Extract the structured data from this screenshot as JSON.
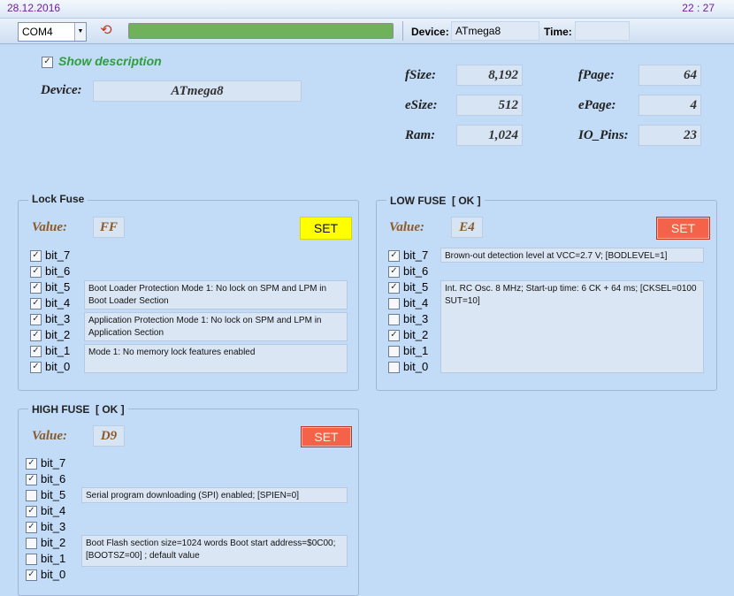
{
  "titlebar": {
    "date": "28.12.2016",
    "time": "22 : 27"
  },
  "toolbar": {
    "port": "COM4",
    "progress": 1.0,
    "device_label": "Device:",
    "device_value": "ATmega8",
    "time_label": "Time:",
    "time_value": ""
  },
  "info": {
    "show_description_label": "Show description",
    "show_description_checked": true,
    "device_label": "Device:",
    "device_value": "ATmega8",
    "fsize_label": "fSize:",
    "fsize": "8,192",
    "esize_label": "eSize:",
    "esize": "512",
    "ram_label": "Ram:",
    "ram": "1,024",
    "fpage_label": "fPage:",
    "fpage": "64",
    "epage_label": "ePage:",
    "epage": "4",
    "iopins_label": "IO_Pins:",
    "iopins": "23"
  },
  "lock_fuse": {
    "title": "Lock Fuse",
    "value_label": "Value:",
    "value": "FF",
    "set_label": "SET",
    "bits": [
      {
        "label": "bit_7",
        "checked": true
      },
      {
        "label": "bit_6",
        "checked": true
      },
      {
        "label": "bit_5",
        "checked": true
      },
      {
        "label": "bit_4",
        "checked": true
      },
      {
        "label": "bit_3",
        "checked": true
      },
      {
        "label": "bit_2",
        "checked": true
      },
      {
        "label": "bit_1",
        "checked": true
      },
      {
        "label": "bit_0",
        "checked": true
      }
    ],
    "desc": [
      "Boot Loader Protection Mode 1: No lock on SPM and LPM in Boot Loader Section",
      "Application Protection Mode 1: No lock on SPM and LPM in Application Section",
      "Mode 1: No memory lock features enabled"
    ]
  },
  "low_fuse": {
    "title": "LOW FUSE  [ OK ]",
    "value_label": "Value:",
    "value": "E4",
    "set_label": "SET",
    "bits": [
      {
        "label": "bit_7",
        "checked": true
      },
      {
        "label": "bit_6",
        "checked": true
      },
      {
        "label": "bit_5",
        "checked": true
      },
      {
        "label": "bit_4",
        "checked": false
      },
      {
        "label": "bit_3",
        "checked": false
      },
      {
        "label": "bit_2",
        "checked": true
      },
      {
        "label": "bit_1",
        "checked": false
      },
      {
        "label": "bit_0",
        "checked": false
      }
    ],
    "desc": [
      "Brown-out detection level at VCC=2.7 V; [BODLEVEL=1]",
      "Int. RC Osc. 8 MHz; Start-up time: 6 CK + 64 ms; [CKSEL=0100 SUT=10]"
    ]
  },
  "high_fuse": {
    "title": "HIGH FUSE  [ OK ]",
    "value_label": "Value:",
    "value": "D9",
    "set_label": "SET",
    "bits": [
      {
        "label": "bit_7",
        "checked": true
      },
      {
        "label": "bit_6",
        "checked": true
      },
      {
        "label": "bit_5",
        "checked": false
      },
      {
        "label": "bit_4",
        "checked": true
      },
      {
        "label": "bit_3",
        "checked": true
      },
      {
        "label": "bit_2",
        "checked": false
      },
      {
        "label": "bit_1",
        "checked": false
      },
      {
        "label": "bit_0",
        "checked": true
      }
    ],
    "desc": [
      "Serial program downloading (SPI) enabled; [SPIEN=0]",
      "Boot Flash section size=1024 words Boot start address=$0C00; [BOOTSZ=00] ; default value"
    ]
  }
}
